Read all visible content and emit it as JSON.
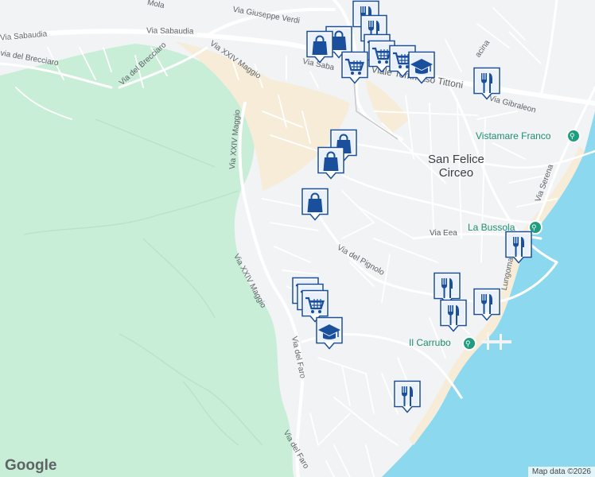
{
  "map": {
    "town": [
      "San Felice",
      "Circeo"
    ],
    "streets": {
      "via_sabaudia_1": "Via Sabaudia",
      "via_sabaudia_2": "Via Sabaudia",
      "via_sabaudia_3": "Via Saba",
      "via_mola": "Mola",
      "via_giuseppe_verdi": "Via Giuseppe Verdi",
      "via_del_brecciaro": "Via del Brecciaro",
      "via_del_brecciaro_2": "via del Brecciaro",
      "via_xxiv_maggio_1": "Via XXIV Maggio",
      "via_xxiv_maggio_2": "Via XXIV Maggio",
      "via_xxiv_maggio_3": "Via XXIV Maggio",
      "viale_tommaso_tittoni": "Viale Tommaso Tittoni",
      "via_gibraleon": "Via Gibraleon",
      "via_eea": "Via Eea",
      "via_del_pignolo": "Via del Pignolo",
      "via_del_faro_1": "Via del Faro",
      "via_del_faro_2": "Via del Faro",
      "via_serena": "Via Serena",
      "lungomare": "Lungomare C",
      "vacina": "acina"
    },
    "pois": {
      "vistamare": "Vistamare Franco",
      "bussola": "La Bussola",
      "carrubo": "Il Carrubo"
    },
    "logo": "Google",
    "attribution": "Map data ©2026"
  },
  "colors": {
    "land": "#f1f3f4",
    "park": "#c8eed8",
    "sand": "#f6ecd8",
    "water": "#8cd8ef",
    "road": "#ffffff",
    "pin": "#1a4f9c",
    "poi": "#1e9e7e"
  },
  "markers": [
    {
      "icon": "cutlery-icon",
      "name": "restaurant-marker"
    },
    {
      "icon": "shopping-bag-icon",
      "name": "shop-marker"
    },
    {
      "icon": "shopping-cart-icon",
      "name": "supermarket-marker"
    },
    {
      "icon": "graduation-cap-icon",
      "name": "school-marker"
    }
  ]
}
